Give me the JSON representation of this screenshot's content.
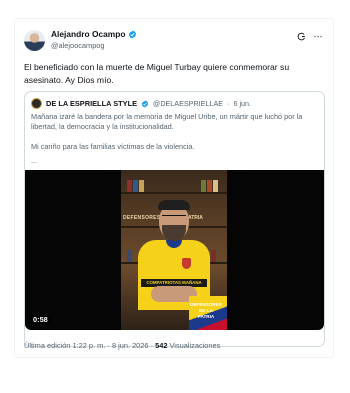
{
  "tweet": {
    "author": {
      "name": "Alejandro Ocampo",
      "handle": "@alejoocampog"
    },
    "text": "El beneficiado con la muerte de Miguel Turbay quiere conmemorar su asesinato. Ay Dios mío.",
    "meta": {
      "edited_label": "Última edición 1:22 p. m.",
      "sep1": "·",
      "date": "8 jun. 2026",
      "sep2": "·",
      "views_count": "542",
      "views_label": "Visualizaciones"
    }
  },
  "quote": {
    "name": "DE LA ESPRIELLA STYLE",
    "handle": "@DELAESPRIELLAE",
    "dot": "·",
    "date": "6 jun.",
    "paragraph1": "Mañana izaré la bandera por la memoria de Miguel Uribe, un mártir que luchó por la libertad, la democracia y la institucionalidad.",
    "paragraph2": "Mi cariño para las familias víctimas de la violencia.",
    "ellipsis": "...",
    "video": {
      "duration": "0:58",
      "sign_left": "DEFENSORES",
      "sign_right": "PATRIA",
      "banner_text": "COMPATRIOTAS MAÑANA IZARÉ",
      "flag_text_line1": "DEFENSORES DE LA",
      "flag_text_line2": "PATRIA"
    }
  },
  "icons": {
    "verified": "verified-badge-icon",
    "grok": "grok-icon",
    "more": "more-icon"
  },
  "colors": {
    "verified_blue": "#1d9bf0",
    "secondary_text": "#536471",
    "primary_text": "#0f1419"
  }
}
